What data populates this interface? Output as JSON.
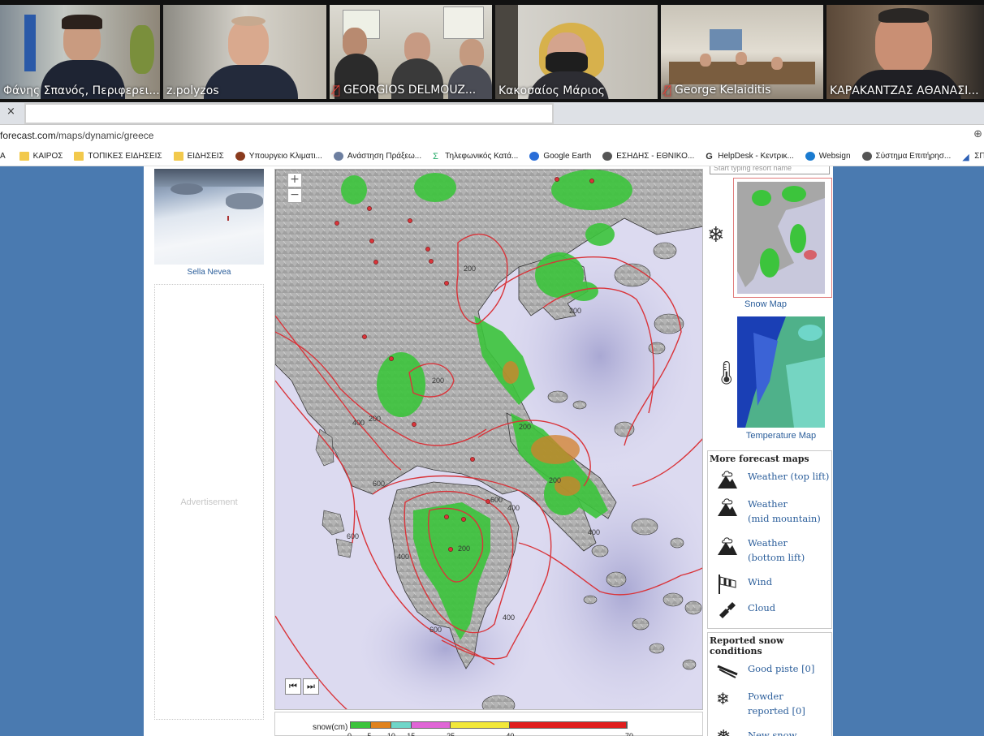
{
  "video_tiles": [
    {
      "name": "Φάνης Σπανός, Περιφερει...",
      "muted": false
    },
    {
      "name": "z.polyzos",
      "muted": false
    },
    {
      "name": "GEORGIOS DELMOUZ...",
      "muted": true
    },
    {
      "name": "Κακοσαίος Μάριος",
      "muted": false
    },
    {
      "name": "George Kelaiditis",
      "muted": true
    },
    {
      "name": "ΚΑΡΑΚΑΝΤΖΑΣ ΑΘΑΝΑΣΙ...",
      "muted": false
    }
  ],
  "tabbar": {
    "close_label": "×"
  },
  "address": {
    "url_prefix": "forecast.com",
    "url_path": "/maps/dynamic/greece"
  },
  "bookmarks": [
    {
      "label": "Α",
      "icon": "blank"
    },
    {
      "label": "ΚΑΙΡΟΣ",
      "icon": "folder-icon"
    },
    {
      "label": "ΤΟΠΙΚΕΣ ΕΙΔΗΣΕΙΣ",
      "icon": "folder-icon"
    },
    {
      "label": "ΕΙΔΗΣΕΙΣ",
      "icon": "folder-icon"
    },
    {
      "label": "Υπουργειο Κλιματι...",
      "icon": "ministry-icon"
    },
    {
      "label": "Ανάστηση Πράξεω...",
      "icon": "globe-icon"
    },
    {
      "label": "Τηλεφωνικός Κατά...",
      "icon": "sigma-icon"
    },
    {
      "label": "Google Earth",
      "icon": "google-earth-icon"
    },
    {
      "label": "ΕΣΗΔΗΣ - ΕΘΝΙΚΟ...",
      "icon": "globe-icon"
    },
    {
      "label": "HelpDesk - Κεντρικ...",
      "icon": "g-icon"
    },
    {
      "label": "Websign",
      "icon": "websign-icon"
    },
    {
      "label": "Σύστημα Επιτήρησ...",
      "icon": "globe-icon"
    },
    {
      "label": "ΣΠΕΡΧΕ",
      "icon": "triangle-icon"
    }
  ],
  "left_column": {
    "resort_caption": "Sella Nevea",
    "ad_label": "Advertisement"
  },
  "map": {
    "zoom_in": "+",
    "zoom_out": "−",
    "contour_labels": [
      "200",
      "200",
      "200",
      "200",
      "400",
      "200",
      "600",
      "600",
      "400",
      "200",
      "400",
      "600",
      "400",
      "600",
      "200",
      "400"
    ]
  },
  "legend": {
    "title": "snow(cm)",
    "bands": [
      {
        "color": "#3cc43c",
        "from": 0,
        "to": 5
      },
      {
        "color": "#e0821e",
        "from": 5,
        "to": 10
      },
      {
        "color": "#6fd6c9",
        "from": 10,
        "to": 15
      },
      {
        "color": "#e066d6",
        "from": 15,
        "to": 25
      },
      {
        "color": "#f2e83a",
        "from": 25,
        "to": 40
      },
      {
        "color": "#e01e1e",
        "from": 40,
        "to": 70
      }
    ],
    "ticks": [
      "0",
      "5",
      "10",
      "15",
      "25",
      "40",
      "70"
    ]
  },
  "right_column": {
    "search_placeholder": "Start typing resort name",
    "snow_map_label": "Snow Map",
    "temp_map_label": "Temperature Map",
    "more_maps": {
      "title": "More forecast maps",
      "items": [
        {
          "label_1": "Weather (top lift)",
          "label_2": "",
          "icon": "weather-top-lift-icon"
        },
        {
          "label_1": "Weather",
          "label_2": "(mid mountain)",
          "icon": "weather-mid-mountain-icon"
        },
        {
          "label_1": "Weather",
          "label_2": "(bottom lift)",
          "icon": "weather-bottom-lift-icon"
        },
        {
          "label_1": "Wind",
          "label_2": "",
          "icon": "windsock-icon"
        },
        {
          "label_1": "Cloud",
          "label_2": "",
          "icon": "satellite-icon"
        }
      ]
    },
    "reported": {
      "title": "Reported snow conditions",
      "items": [
        {
          "label_1": "Good piste [0]",
          "label_2": "",
          "icon": "skis-icon"
        },
        {
          "label_1": "Powder",
          "label_2": "reported [0]",
          "icon": "powder-icon"
        },
        {
          "label_1": "New snow",
          "label_2": "",
          "icon": "snowflake-icon"
        }
      ]
    }
  }
}
